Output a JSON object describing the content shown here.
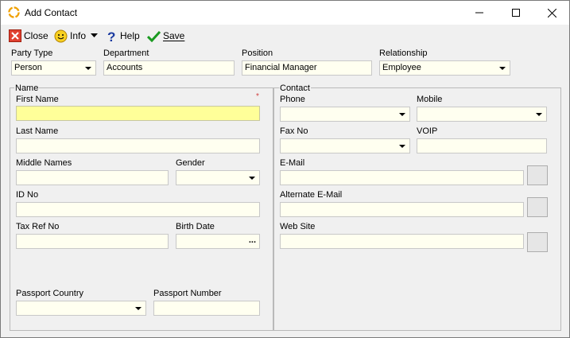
{
  "window": {
    "title": "Add Contact"
  },
  "toolbar": {
    "close_label": "Close",
    "info_label": "Info",
    "help_label": "Help",
    "save_label": "Save"
  },
  "top": {
    "party_type_label": "Party Type",
    "party_type_value": "Person",
    "department_label": "Department",
    "department_value": "Accounts",
    "position_label": "Position",
    "position_value": "Financial Manager",
    "relationship_label": "Relationship",
    "relationship_value": "Employee"
  },
  "name_group": {
    "title": "Name",
    "required_mark": "*",
    "first_name_label": "First Name",
    "first_name_value": "",
    "last_name_label": "Last Name",
    "last_name_value": "",
    "middle_names_label": "Middle Names",
    "middle_names_value": "",
    "gender_label": "Gender",
    "gender_value": "",
    "id_no_label": "ID No",
    "id_no_value": "",
    "tax_ref_label": "Tax Ref No",
    "tax_ref_value": "",
    "birth_date_label": "Birth Date",
    "birth_date_value": "",
    "birth_date_button": "...",
    "passport_country_label": "Passport Country",
    "passport_country_value": "",
    "passport_number_label": "Passport Number",
    "passport_number_value": ""
  },
  "contact_group": {
    "title": "Contact",
    "phone_label": "Phone",
    "mobile_label": "Mobile",
    "fax_label": "Fax No",
    "voip_label": "VOIP",
    "email_label": "E-Mail",
    "alt_email_label": "Alternate E-Mail",
    "website_label": "Web Site"
  },
  "colors": {
    "field_bg": "#fffff0",
    "required_field_bg": "#ffff99",
    "window_bg": "#f0f0f0"
  }
}
